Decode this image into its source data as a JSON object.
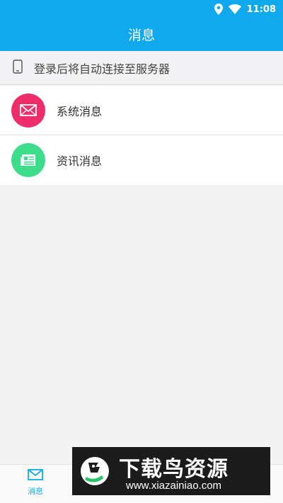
{
  "statusbar": {
    "time": "11:08",
    "icons": [
      "location-icon",
      "wifi-icon"
    ]
  },
  "header": {
    "title": "消息"
  },
  "notice": {
    "icon": "phone-icon",
    "text": "登录后将自动连接至服务器"
  },
  "list": {
    "items": [
      {
        "label": "系统消息",
        "icon": "envelope-icon",
        "color": "#ee2d6b"
      },
      {
        "label": "资讯消息",
        "icon": "news-icon",
        "color": "#3ddd8b"
      }
    ]
  },
  "tabbar": {
    "tabs": [
      {
        "label": "消息",
        "icon": "envelope-icon",
        "active": true
      }
    ]
  },
  "watermark": {
    "title": "下载鸟资源",
    "url": "www.xiazainiao.com"
  },
  "colors": {
    "primary": "#10a9ee",
    "pink": "#ee2d6b",
    "green": "#3ddd8b"
  }
}
